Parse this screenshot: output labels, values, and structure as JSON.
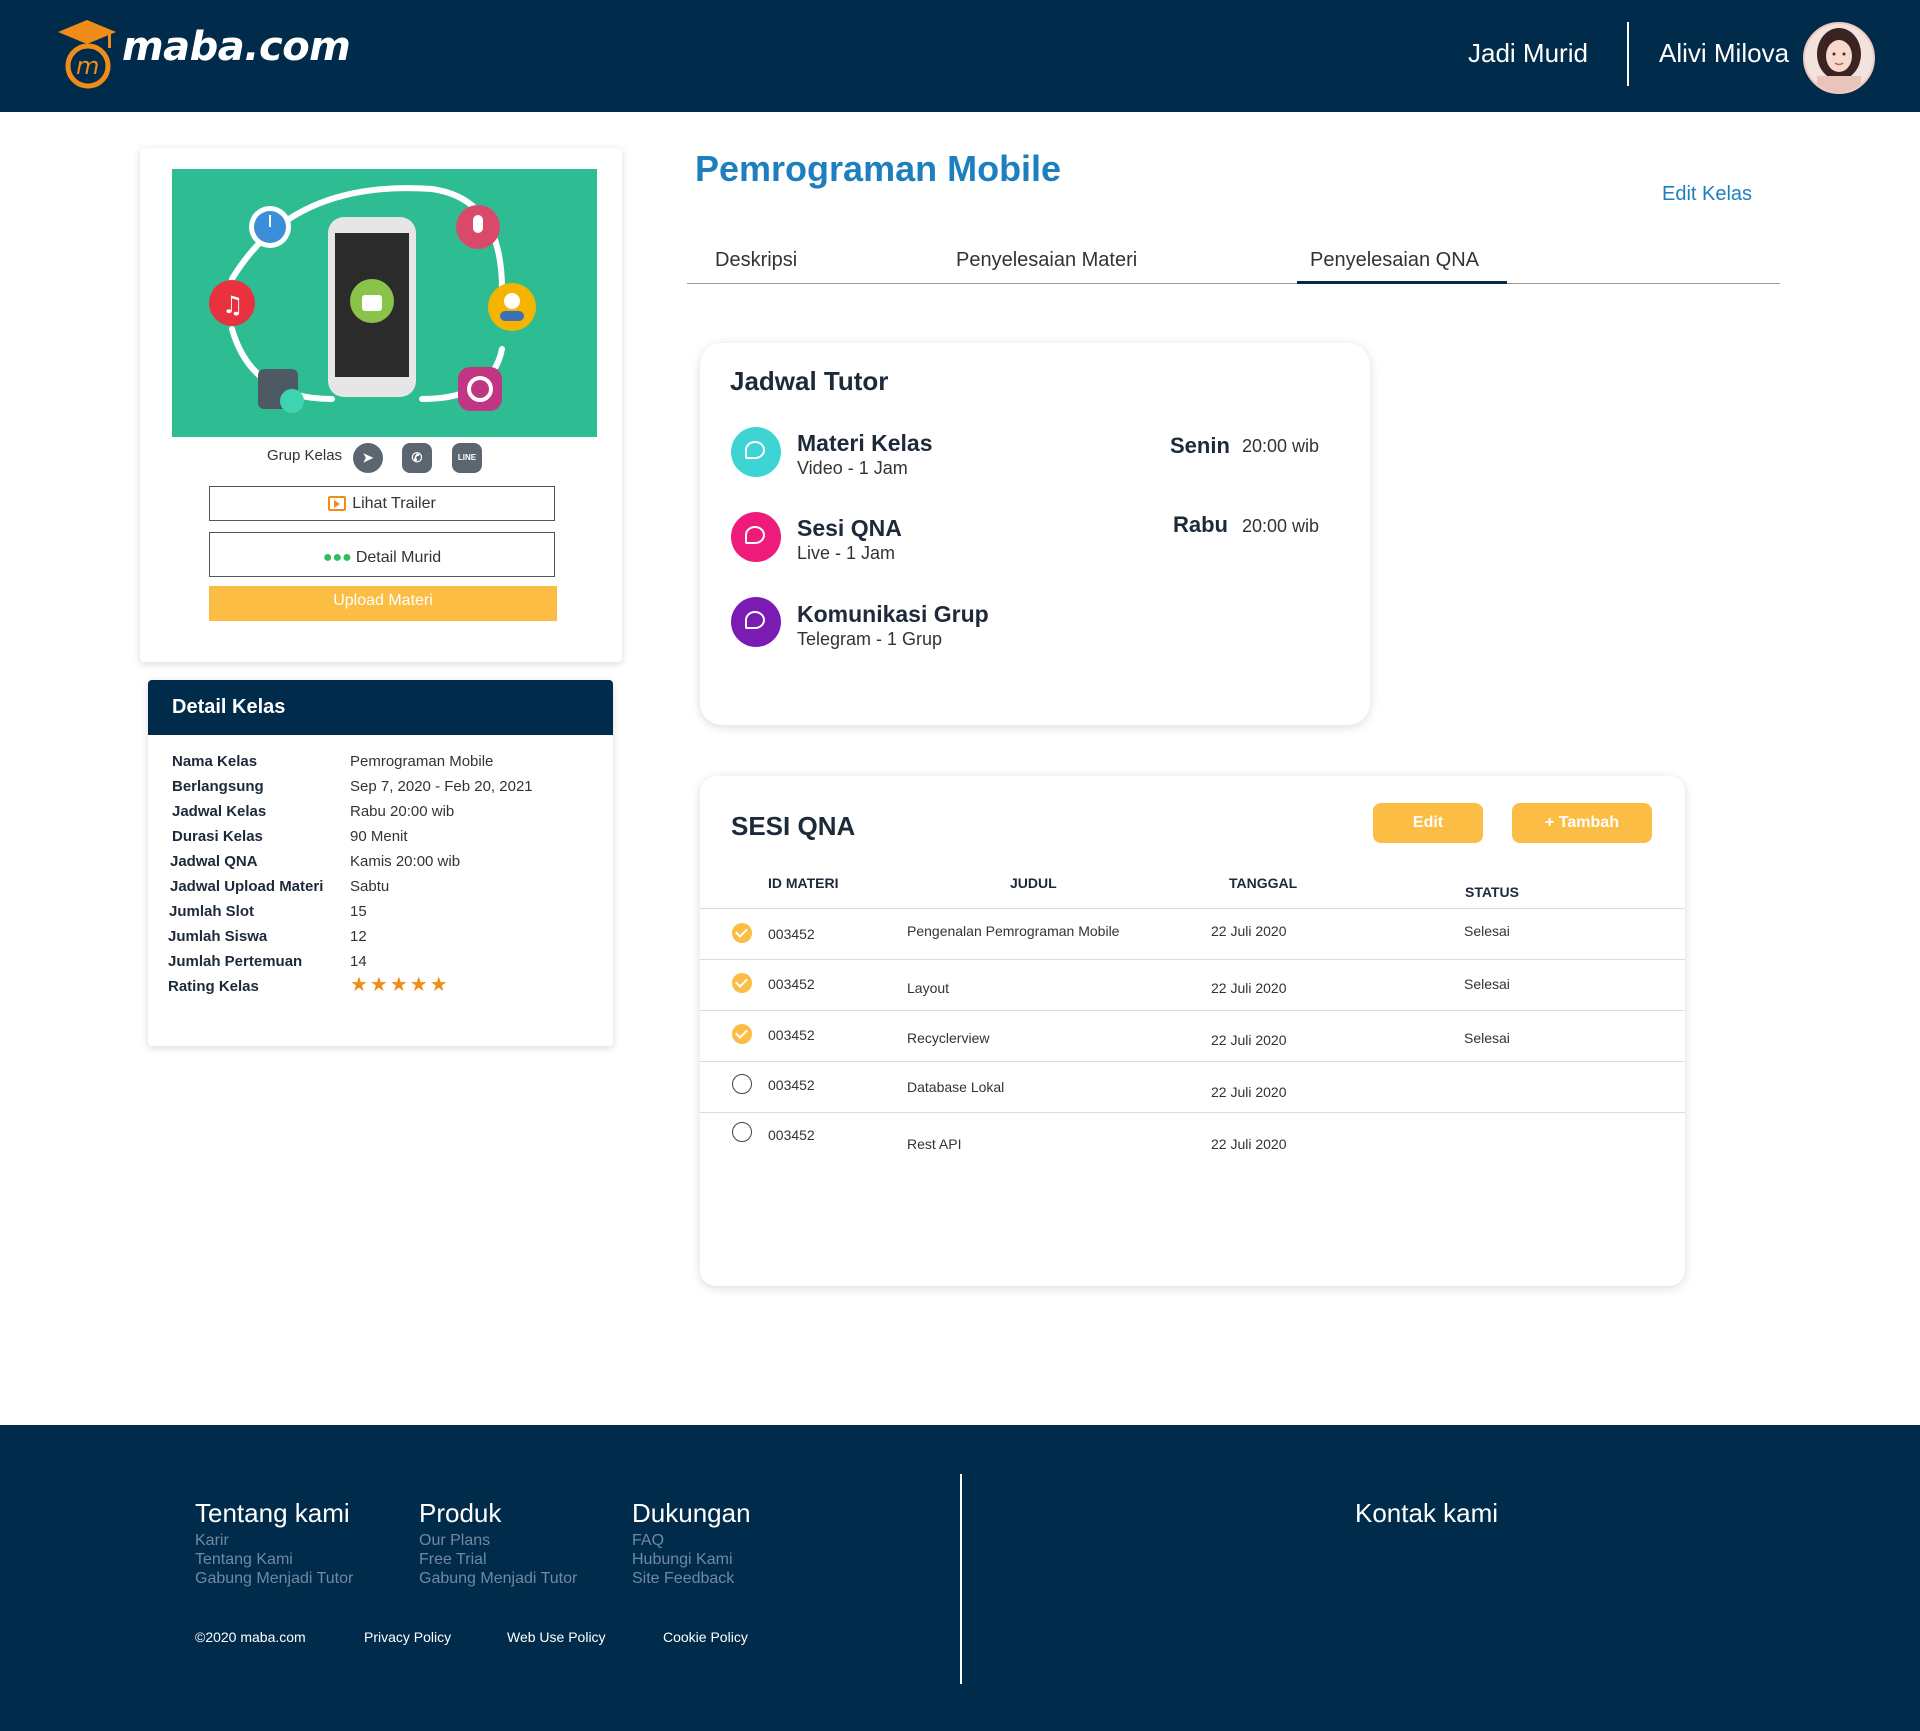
{
  "header": {
    "logo_text": "maba.com",
    "logo_letter": "m",
    "nav_jadi_murid": "Jadi Murid",
    "user_name": "Alivi Milova"
  },
  "class_card": {
    "grup_label": "Grup Kelas",
    "group_icons": [
      "telegram-icon",
      "whatsapp-icon",
      "line-icon"
    ],
    "line_icon_text": "LINE",
    "lihat_trailer": "Lihat Trailer",
    "detail_murid": "Detail Murid",
    "upload_materi": "Upload Materi"
  },
  "detail_kelas": {
    "title": "Detail Kelas",
    "rows": [
      {
        "label": "Nama Kelas",
        "value": "Pemrograman Mobile"
      },
      {
        "label": "Berlangsung",
        "value": "Sep 7, 2020 - Feb 20, 2021"
      },
      {
        "label": "Jadwal Kelas",
        "value": "Rabu 20:00 wib"
      },
      {
        "label": "Durasi Kelas",
        "value": "90 Menit"
      },
      {
        "label": "Jadwal QNA",
        "value": "Kamis 20:00 wib"
      },
      {
        "label": "Jadwal Upload Materi",
        "value": "Sabtu"
      },
      {
        "label": "Jumlah Slot",
        "value": "15"
      },
      {
        "label": "Jumlah Siswa",
        "value": "12"
      },
      {
        "label": "Jumlah Pertemuan",
        "value": "14"
      },
      {
        "label": "Rating Kelas",
        "value": "★★★★★"
      }
    ],
    "rating": 5
  },
  "main": {
    "title": "Pemrograman Mobile",
    "edit_kelas": "Edit Kelas",
    "tabs": [
      {
        "label": "Deskripsi",
        "active": false
      },
      {
        "label": "Penyelesaian Materi",
        "active": false
      },
      {
        "label": "Penyelesaian QNA",
        "active": true
      }
    ]
  },
  "jadwal_tutor": {
    "title": "Jadwal Tutor",
    "items": [
      {
        "name": "Materi Kelas",
        "sub": "Video - 1 Jam",
        "day": "Senin",
        "time": "20:00 wib",
        "color": "#3fd4d4"
      },
      {
        "name": "Sesi QNA",
        "sub": "Live - 1 Jam",
        "day": "Rabu",
        "time": "20:00 wib",
        "color": "#ee1b7a"
      },
      {
        "name": "Komunikasi Grup",
        "sub": "Telegram - 1 Grup",
        "day": "",
        "time": "",
        "color": "#7a1bb3"
      }
    ]
  },
  "sesi_qna": {
    "title": "SESI QNA",
    "edit_label": "Edit",
    "add_label": "+ Tambah",
    "columns": [
      "ID MATERI",
      "JUDUL",
      "TANGGAL",
      "STATUS"
    ],
    "rows": [
      {
        "checked": true,
        "id": "003452",
        "judul": "Pengenalan Pemrograman Mobile",
        "tanggal": "22 Juli 2020",
        "status": "Selesai"
      },
      {
        "checked": true,
        "id": "003452",
        "judul": "Layout",
        "tanggal": "22 Juli 2020",
        "status": "Selesai"
      },
      {
        "checked": true,
        "id": "003452",
        "judul": "Recyclerview",
        "tanggal": "22 Juli 2020",
        "status": "Selesai"
      },
      {
        "checked": false,
        "id": "003452",
        "judul": "Database Lokal",
        "tanggal": "22 Juli 2020",
        "status": ""
      },
      {
        "checked": false,
        "id": "003452",
        "judul": "Rest API",
        "tanggal": "22 Juli 2020",
        "status": ""
      }
    ]
  },
  "footer": {
    "tentang": {
      "title": "Tentang kami",
      "links": [
        "Karir",
        "Tentang Kami",
        "Gabung Menjadi Tutor"
      ]
    },
    "produk": {
      "title": "Produk",
      "links": [
        "Our Plans",
        "Free Trial",
        "Gabung Menjadi Tutor"
      ]
    },
    "dukungan": {
      "title": "Dukungan",
      "links": [
        "FAQ",
        "Hubungi Kami",
        "Site Feedback"
      ]
    },
    "kontak": "Kontak kami",
    "copyright": "©2020 maba.com",
    "privacy": "Privacy Policy",
    "web_use": "Web Use Policy",
    "cookie": "Cookie Policy"
  },
  "colors": {
    "navy": "#002b4a",
    "accent_blue": "#1e7fbf",
    "yellow": "#fcbd45",
    "banner_green": "#2ebd93",
    "logo_orange": "#f08c1a"
  }
}
